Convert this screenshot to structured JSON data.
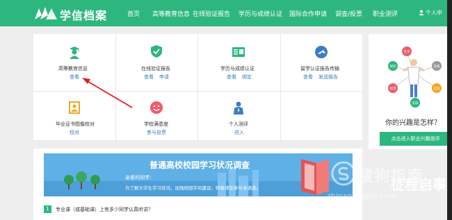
{
  "header": {
    "logo_text": "学信档案",
    "nav": [
      "首页",
      "高等教育信息",
      "在线验证报告",
      "学历与成绩认证",
      "国际合作申请",
      "调查/投票",
      "职业测评"
    ],
    "user": "个人中"
  },
  "grid": {
    "cells": [
      {
        "title": "高等教育信息",
        "links": [
          "查看"
        ],
        "icon": "graduate-icon"
      },
      {
        "title": "在线验证报告",
        "links": [
          "查看",
          "申请"
        ],
        "icon": "shield-check-icon"
      },
      {
        "title": "学历与成绩认证",
        "links": [
          "查看",
          "绑定"
        ],
        "icon": "certificate-icon"
      },
      {
        "title": "留学认证报告传输",
        "links": [
          "查看",
          "发送报告"
        ],
        "icon": "globe-plane-icon"
      },
      {
        "title": "毕业证书图像校对",
        "links": [
          "校对"
        ],
        "icon": "portrait-icon"
      },
      {
        "title": "学校满意度",
        "links": [
          "参与投票"
        ],
        "icon": "smiley-icon"
      },
      {
        "title": "个人测评",
        "links": [
          "进入"
        ],
        "icon": "person-icon"
      }
    ]
  },
  "sidebar": {
    "question": "你的兴趣是怎样？",
    "button": "点击进入职业兴趣测评",
    "bubbles": [
      "研究",
      "艺术",
      "常规",
      "社会",
      "经营",
      "实际"
    ]
  },
  "survey": {
    "title": "普通高校校园学习状况调查",
    "greeting": "亲爱的同学：",
    "desc": "为了解大学生学习状况，加强校园学风建设，特邀请您参与本调查。",
    "question_number": "1",
    "question": "专业课（或基础课）上有多少同学认真听讲？"
  },
  "watermark": {
    "text": "搜狗指南",
    "url": "zhinan.sogou.com",
    "side": "征程启事"
  },
  "colors": {
    "brand": "#2db77f",
    "link": "#3b7cc4",
    "banner": "#5fb0e6",
    "arrow": "#e02020"
  }
}
